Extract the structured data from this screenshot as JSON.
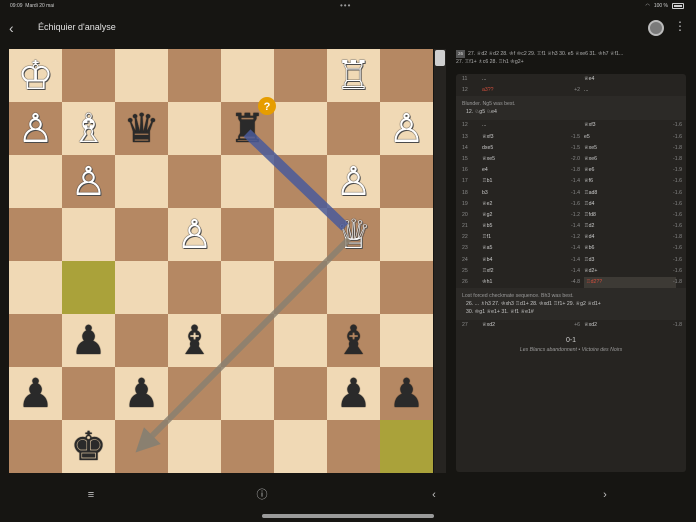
{
  "status_bar": {
    "time": "09:09",
    "date": "Mardi 20 mai",
    "dots": "•••",
    "battery": "100 %"
  },
  "header": {
    "back_icon": "‹",
    "title": "Échiquier d'analyse",
    "menu_icon": "⋮"
  },
  "board": {
    "squares": [
      [
        "♔",
        "",
        "",
        "",
        "",
        "",
        "♖",
        ""
      ],
      [
        "♙",
        "♗",
        "♛",
        "",
        "♜",
        "",
        "",
        "♙"
      ],
      [
        "",
        "♙",
        "",
        "",
        "",
        "",
        "♙",
        ""
      ],
      [
        "",
        "",
        "",
        "♙",
        "",
        "",
        "♕",
        ""
      ],
      [
        "",
        "",
        "",
        "",
        "",
        "",
        "",
        ""
      ],
      [
        "",
        "♟",
        "",
        "♝",
        "",
        "",
        "♝",
        ""
      ],
      [
        "♟",
        "",
        "♟",
        "",
        "",
        "",
        "♟",
        "♟"
      ],
      [
        "",
        "♚",
        "",
        "",
        "",
        "",
        "",
        ""
      ]
    ],
    "colors": [
      [
        "w",
        "",
        "",
        "",
        "",
        "",
        "w",
        ""
      ],
      [
        "w",
        "w",
        "b",
        "",
        "b",
        "",
        "",
        "w"
      ],
      [
        "",
        "w",
        "",
        "",
        "",
        "",
        "w",
        ""
      ],
      [
        "",
        "",
        "",
        "w",
        "",
        "",
        "w",
        ""
      ],
      [
        "",
        "",
        "",
        "",
        "",
        "",
        "",
        ""
      ],
      [
        "",
        "b",
        "",
        "b",
        "",
        "",
        "b",
        ""
      ],
      [
        "b",
        "",
        "b",
        "",
        "",
        "",
        "b",
        "b"
      ],
      [
        "",
        "b",
        "",
        "",
        "",
        "",
        "",
        ""
      ]
    ],
    "highlight_squares": [
      "b4",
      "h1"
    ],
    "annotation_badge": "?",
    "annotation_color": "#e69d00",
    "arrow_colors": {
      "blue": "#4a5a9a",
      "gray": "#8a8070"
    }
  },
  "moves_header": {
    "line1_badge": "26",
    "line1": "27. ♕d2 ♕d2 28. ♔f ♔c2 29. ♖f1 ♕h3 30. e5 ♕xe6 31. ♔h7 ♕f1...",
    "line2": "27. ♖f1+ ♗c6 28. ♖h1 ♔g2+"
  },
  "moves_panel": {
    "rows_a": [
      {
        "n": "11",
        "w": "...",
        "we": "",
        "b": "♕e4",
        "be": ""
      },
      {
        "n": "12",
        "w": "a3??",
        "we": "+2",
        "b": "...",
        "be": "",
        "w_red": true
      }
    ],
    "comment1": "Blunder. Ng5 was best.",
    "variation1": "12. ♘g5  ♘e4",
    "rows_b": [
      {
        "n": "12",
        "w": "...",
        "we": "",
        "b": "♕xf3",
        "be": "-1.6"
      },
      {
        "n": "13",
        "w": "♕xf3",
        "we": "-1.5",
        "b": "e5",
        "be": "-1.6"
      },
      {
        "n": "14",
        "w": "dxe5",
        "we": "-1.5",
        "b": "♕xe5",
        "be": "-1.8"
      },
      {
        "n": "15",
        "w": "♕xe5",
        "we": "-2.0",
        "b": "♕xe6",
        "be": "-1.8"
      },
      {
        "n": "16",
        "w": "e4",
        "we": "-1.8",
        "b": "♕e6",
        "be": "-1.9"
      },
      {
        "n": "17",
        "w": "♖b1",
        "we": "-1.4",
        "b": "♕f6",
        "be": "-1.6"
      },
      {
        "n": "18",
        "w": "b3",
        "we": "-1.4",
        "b": "♖ad8",
        "be": "-1.6"
      },
      {
        "n": "19",
        "w": "♕e2",
        "we": "-1.6",
        "b": "♖d4",
        "be": "-1.6"
      },
      {
        "n": "20",
        "w": "♕g2",
        "we": "-1.2",
        "b": "♖fd8",
        "be": "-1.6"
      },
      {
        "n": "21",
        "w": "♕b5",
        "we": "-1.4",
        "b": "♖d2",
        "be": "-1.6"
      },
      {
        "n": "22",
        "w": "♖f1",
        "we": "-1.2",
        "b": "♕d4",
        "be": "-1.8"
      },
      {
        "n": "23",
        "w": "♕a5",
        "we": "-1.4",
        "b": "♕b6",
        "be": "-1.6"
      },
      {
        "n": "24",
        "w": "♕b4",
        "we": "-1.4",
        "b": "♖d3",
        "be": "-1.6"
      },
      {
        "n": "25",
        "w": "♖xf2",
        "we": "-1.4",
        "b": "♕d2+",
        "be": "-1.6"
      },
      {
        "n": "26",
        "w": "♔h1",
        "we": "-4.8",
        "b": "♖d2??",
        "be": "-1.8",
        "b_red": true,
        "b_sel": true
      }
    ],
    "comment2": "Lost forced checkmate sequence. Bh3 was best.",
    "variation2a": "26. ... ♗h3  27. ♔xh3  ♖d1+  28. ♔xd1  ♖f1+  29. ♕g2  ♕d1+",
    "variation2b": "30. ♔g1  ♕e1+  31. ♕f1  ♕e1#",
    "rows_c": [
      {
        "n": "27",
        "w": "♕xd2",
        "we": "+6",
        "b": "♕xd2",
        "be": "-1.8"
      }
    ],
    "result": "0-1",
    "result_text": "Les Blancs abandonnent • Victoire des Noirs"
  },
  "bottom_bar": {
    "menu_icon": "≡",
    "info_icon": "ⓘ",
    "prev_icon": "‹",
    "next_icon": "›"
  }
}
